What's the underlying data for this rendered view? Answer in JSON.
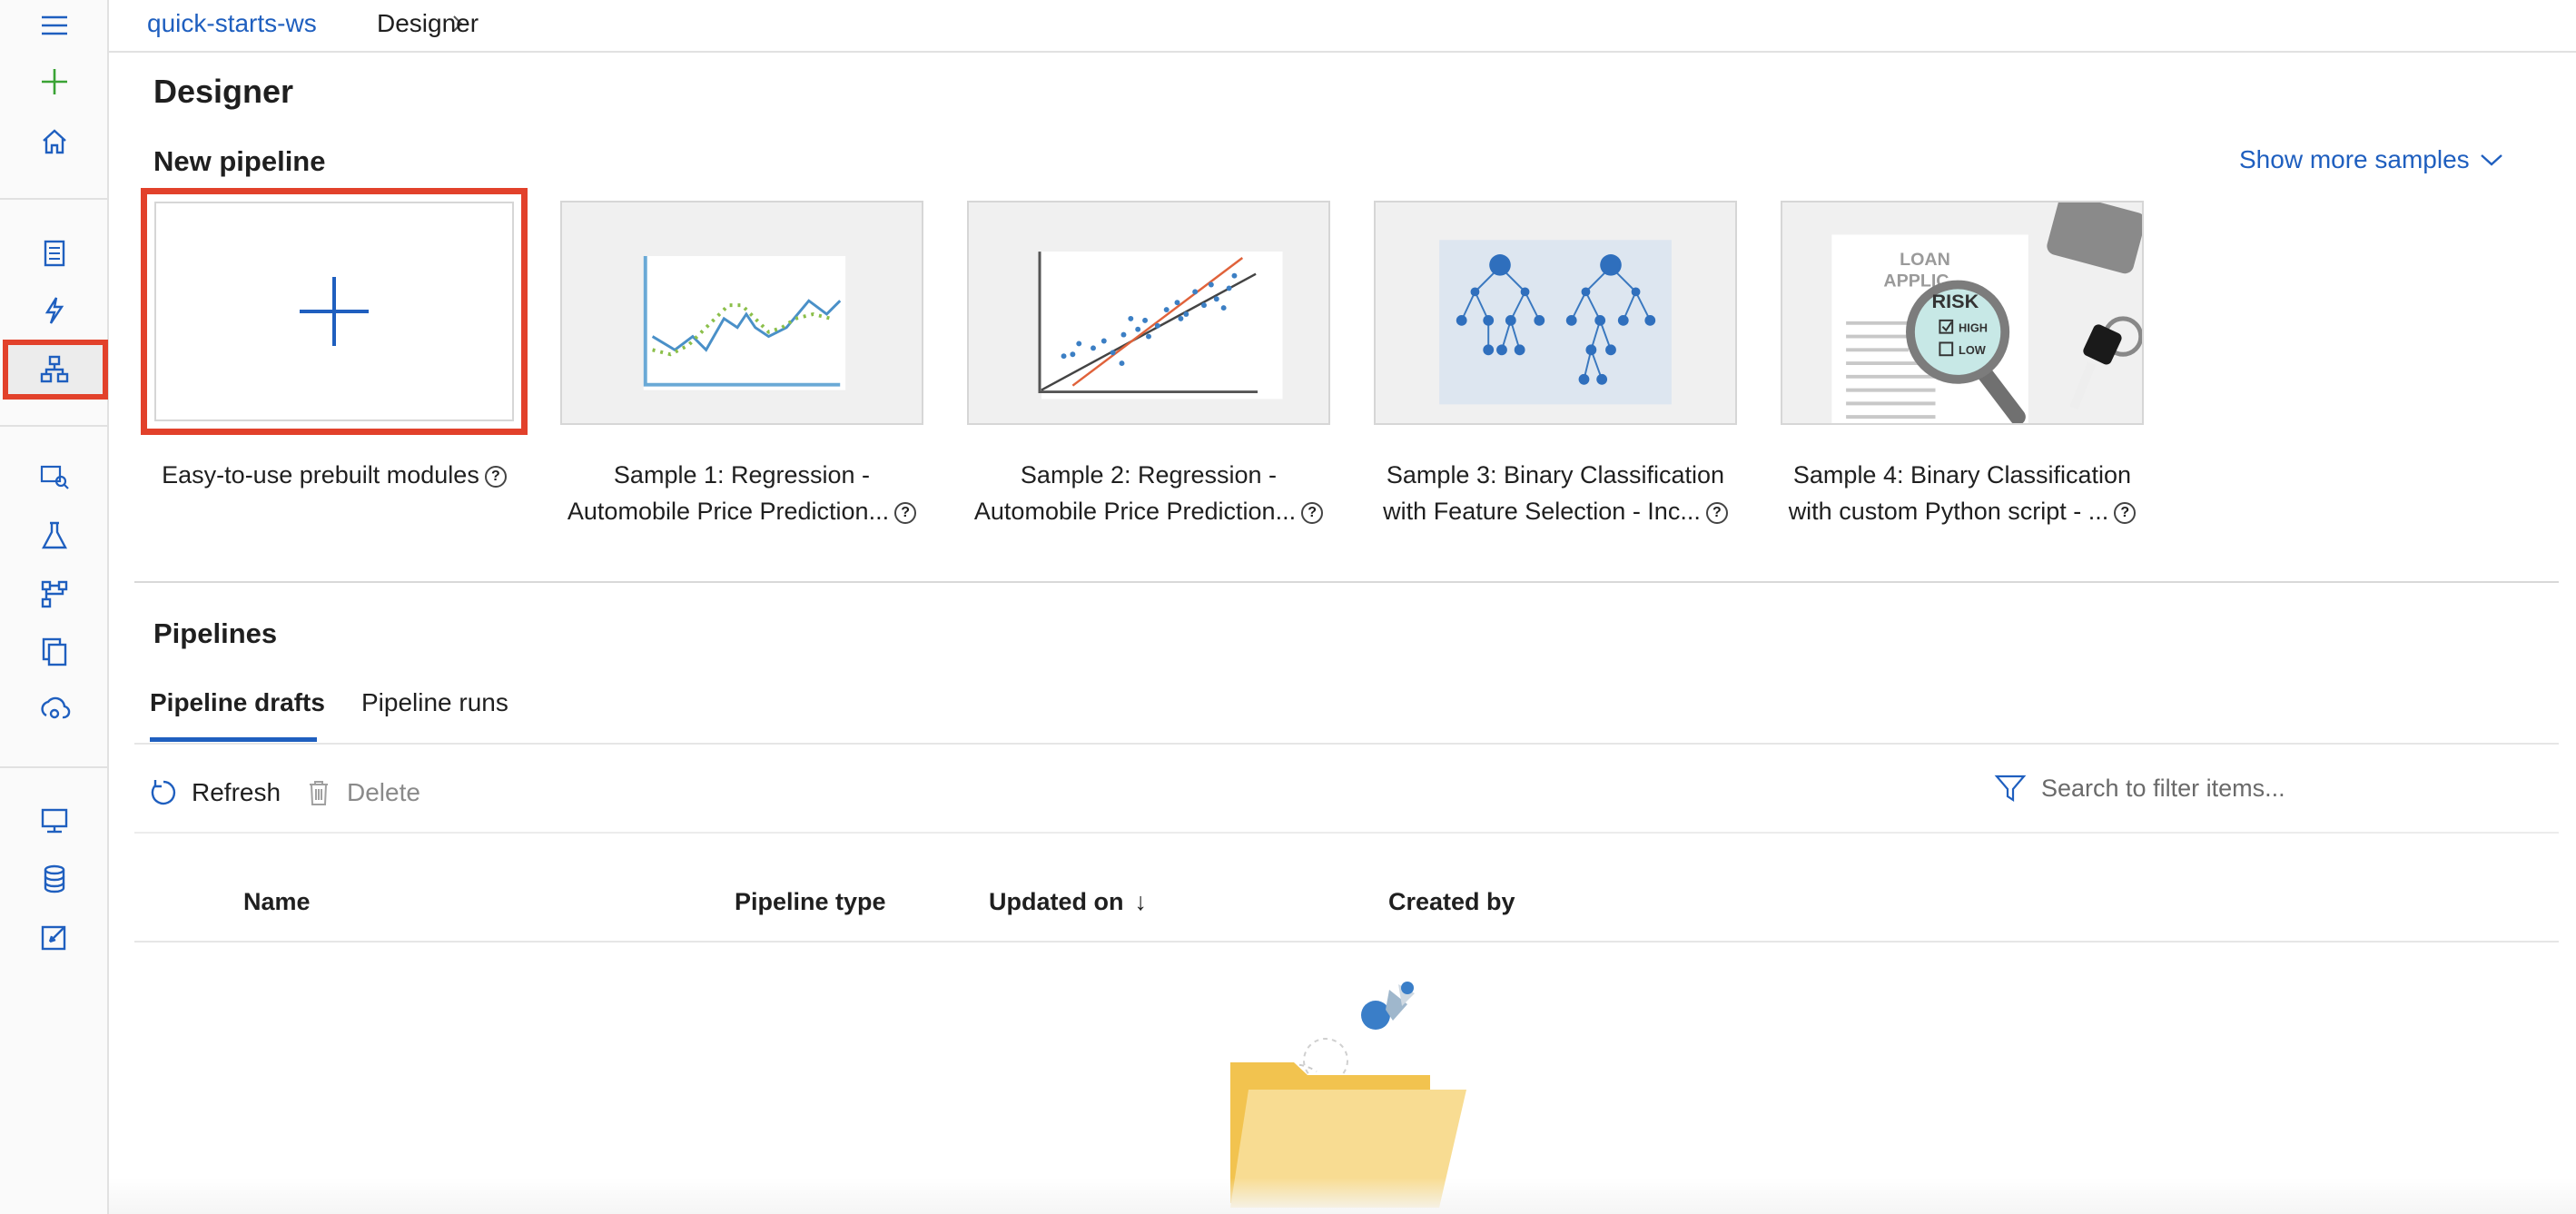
{
  "breadcrumb": {
    "workspace": "quick-starts-ws",
    "current": "Designer"
  },
  "page": {
    "title": "Designer"
  },
  "new_pipeline": {
    "title": "New pipeline",
    "show_more": "Show more samples",
    "tiles": [
      {
        "caption_line1": "Easy-to-use prebuilt modules",
        "caption_line2": ""
      },
      {
        "caption_line1": "Sample 1: Regression -",
        "caption_line2": "Automobile Price Prediction..."
      },
      {
        "caption_line1": "Sample 2: Regression -",
        "caption_line2": "Automobile Price Prediction..."
      },
      {
        "caption_line1": "Sample 3: Binary Classification",
        "caption_line2": "with Feature Selection - Inc..."
      },
      {
        "caption_line1": "Sample 4: Binary Classification",
        "caption_line2": "with custom Python script - ..."
      }
    ],
    "sample4_art": {
      "doc_heading": "LOAN",
      "doc_heading2": "APPLIC",
      "risk": "RISK",
      "high": "HIGH",
      "low": "LOW"
    }
  },
  "pipelines": {
    "title": "Pipelines",
    "tabs": [
      {
        "label": "Pipeline drafts",
        "active": true
      },
      {
        "label": "Pipeline runs",
        "active": false
      }
    ],
    "commands": {
      "refresh": "Refresh",
      "delete": "Delete"
    },
    "search_placeholder": "Search to filter items...",
    "columns": [
      "Name",
      "Pipeline type",
      "Updated on",
      "Created by"
    ],
    "sort_indicator": "↓"
  },
  "colors": {
    "accent": "#1f5fbf",
    "highlight_box": "#e2412b",
    "add_icon": "#3aa335"
  },
  "icons": {
    "rail": [
      "hamburger-icon",
      "plus-icon",
      "home-icon",
      "notebook-icon",
      "automl-icon",
      "designer-icon",
      "datasets-icon",
      "experiments-icon",
      "pipelines-icon",
      "models-icon",
      "endpoints-icon",
      "compute-icon",
      "datastores-icon",
      "labeling-icon"
    ]
  }
}
